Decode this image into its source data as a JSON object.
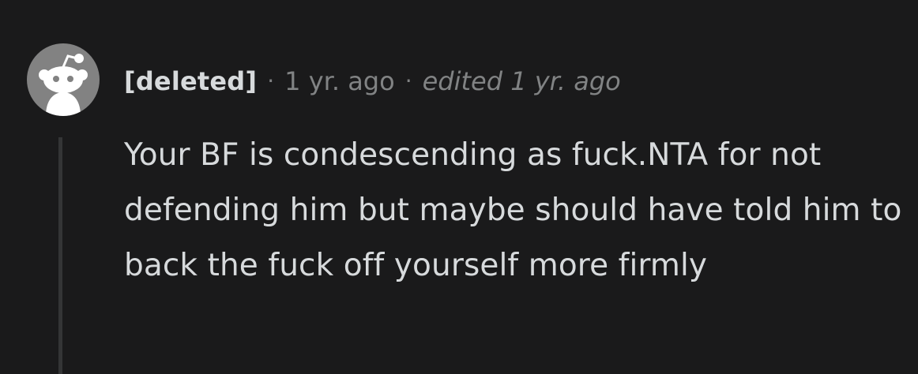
{
  "comment": {
    "author": "[deleted]",
    "separator": "·",
    "timestamp": "1 yr. ago",
    "edited": "edited 1 yr. ago",
    "body": "Your BF is condescending as fuck.NTA for not defending him but maybe should have told him to back the fuck off yourself more firmly"
  },
  "avatar": {
    "icon": "snoo-icon",
    "background_color": "#828282",
    "foreground_color": "#ffffff"
  },
  "colors": {
    "background": "#1a1a1b",
    "text_primary": "#d7dadc",
    "text_meta": "#818384",
    "thread_line": "#343536"
  }
}
